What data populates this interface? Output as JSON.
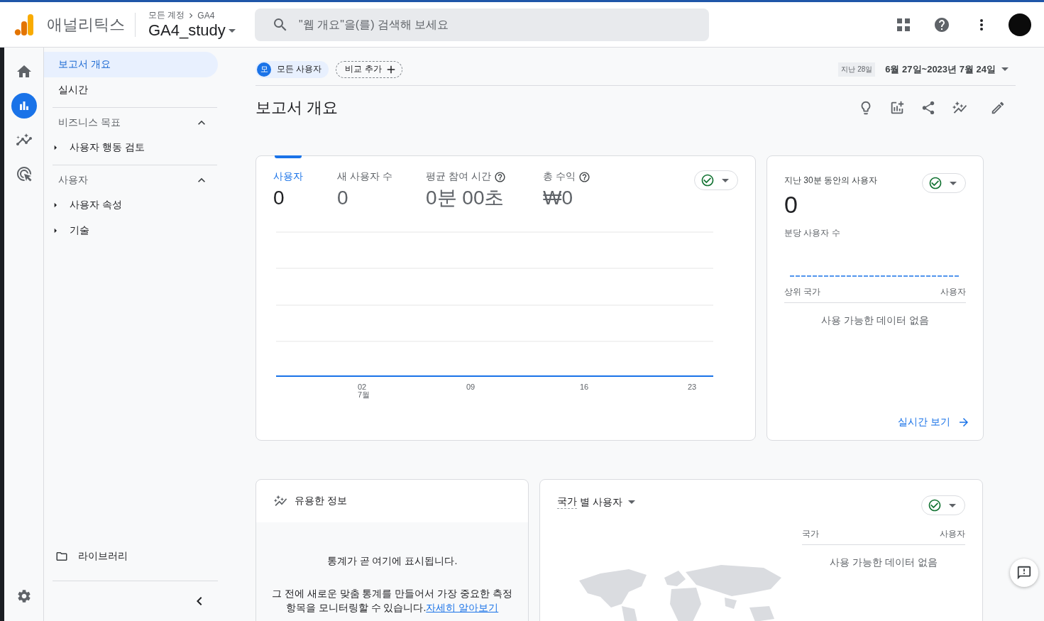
{
  "header": {
    "product": "애널리틱스",
    "breadcrumb": [
      "모든 계정",
      "GA4"
    ],
    "property": "GA4_study",
    "search": {
      "placeholder": "\"웹 개요\"을(를) 검색해 보세요"
    }
  },
  "rail": [
    {
      "kind": "home",
      "selected": false
    },
    {
      "kind": "reports",
      "selected": true
    },
    {
      "kind": "explore",
      "selected": false
    },
    {
      "kind": "advertising",
      "selected": false
    }
  ],
  "nav": {
    "items": [
      {
        "label": "보고서 개요",
        "selected": true
      },
      {
        "label": "실시간",
        "selected": false
      }
    ],
    "sections": [
      {
        "title": "비즈니스 목표",
        "expanded": true,
        "children": [
          {
            "label": "사용자 행동 검토",
            "expanded": false
          }
        ]
      },
      {
        "title": "사용자",
        "expanded": true,
        "children": [
          {
            "label": "사용자 속성",
            "expanded": false
          },
          {
            "label": "기술",
            "expanded": false
          }
        ]
      }
    ],
    "library": "라이브러리"
  },
  "filters": {
    "segment": {
      "badge": "모",
      "label": "모든 사용자"
    },
    "compare": "비교 추가"
  },
  "date_range": {
    "preset": "지난 28일",
    "range": "6월 27일~2023년 7월 24일"
  },
  "page_title": "보고서 개요",
  "overview_card": {
    "metrics": [
      {
        "label": "사용자",
        "value": "0",
        "selected": true,
        "help": false
      },
      {
        "label": "새 사용자 수",
        "value": "0",
        "selected": false,
        "help": false
      },
      {
        "label": "평균 참여 시간",
        "value": "0분 00초",
        "selected": false,
        "help": true
      },
      {
        "label": "총 수익",
        "value": "₩0",
        "selected": false,
        "help": true
      }
    ],
    "x_labels": [
      {
        "day": "02",
        "month": "7월"
      },
      {
        "day": "09"
      },
      {
        "day": "16"
      },
      {
        "day": "23"
      }
    ]
  },
  "realtime_card": {
    "title": "지난 30분 동안의 사용자",
    "value": "0",
    "subtitle": "분당 사용자 수",
    "columns": [
      "상위 국가",
      "사용자"
    ],
    "empty": "사용 가능한 데이터 없음",
    "link": "실시간 보기"
  },
  "insights_card": {
    "title": "유용한 정보",
    "heading": "통계가 곧 여기에 표시됩니다.",
    "body": "그 전에 새로운 맞춤 통계를 만들어서 가장 중요한 측정 항목을 모니터링할 수 있습니다.",
    "link": "자세히 알아보기"
  },
  "country_card": {
    "dimension": "국가",
    "title_rest": "별 사용자",
    "columns": [
      "국가",
      "사용자"
    ],
    "empty": "사용 가능한 데이터 없음"
  }
}
